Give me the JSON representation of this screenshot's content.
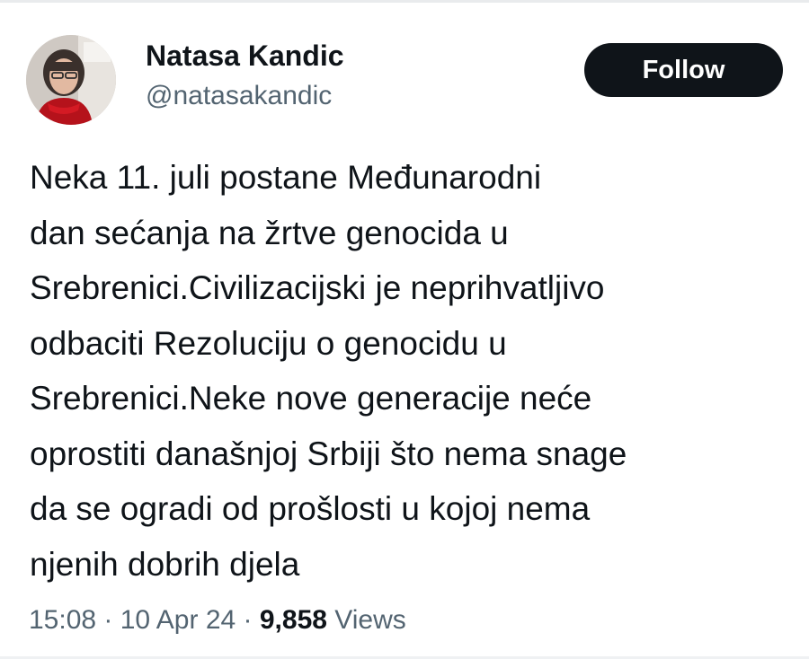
{
  "author": {
    "display_name": "Natasa Kandic",
    "handle": "@natasakandic"
  },
  "follow_button": {
    "label": "Follow"
  },
  "tweet": {
    "lines": [
      "Neka 11. juli postane Međunarodni",
      "dan sećanja na žrtve genocida u",
      "Srebrenici.Civilizacijski je neprihvatljivo",
      "odbaciti Rezoluciju o genocidu u",
      "Srebrenici.Neke nove generacije neće",
      "oprostiti današnjoj Srbiji što nema snage",
      "da se ogradi od prošlosti u kojoj nema",
      "njenih dobrih djela"
    ]
  },
  "meta": {
    "time": "15:08",
    "separator": " · ",
    "date": "10 Apr 24",
    "views_count": "9,858",
    "views_label": " Views"
  },
  "colors": {
    "text_primary": "#0f1419",
    "text_secondary": "#536471",
    "follow_bg": "#0f1419",
    "follow_text": "#ffffff"
  }
}
